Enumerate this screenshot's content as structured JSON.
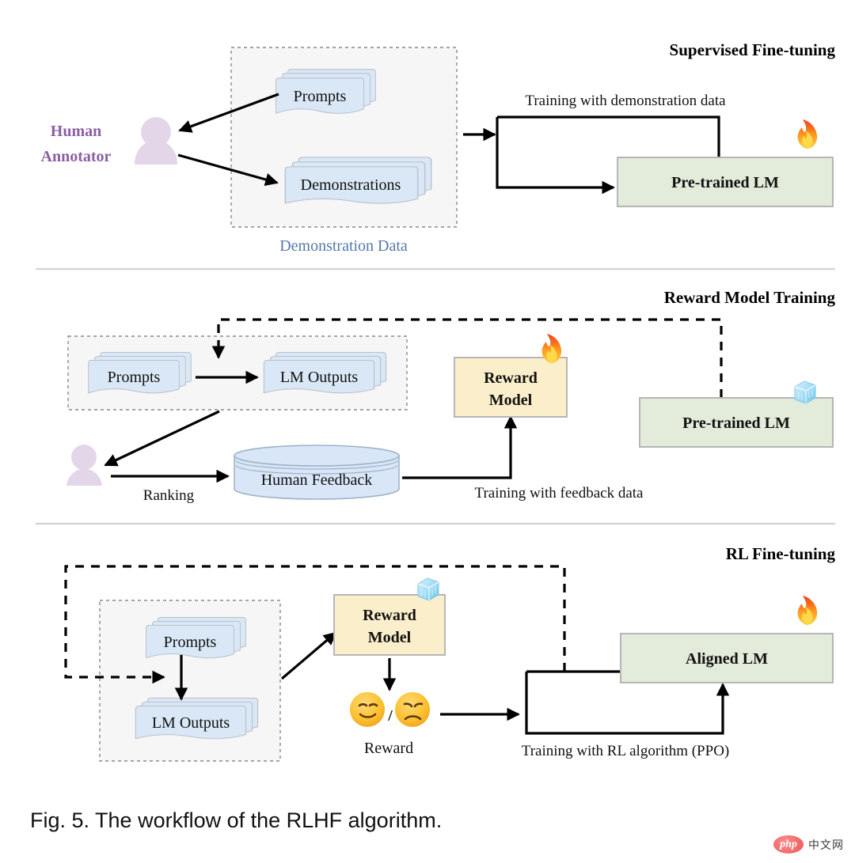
{
  "figure": {
    "caption": "Fig. 5. The workflow of the RLHF algorithm.",
    "watermark": {
      "brand": "php",
      "suffix": "中文网"
    },
    "colors": {
      "doc_fill": "#dae7f6",
      "green_box_fill": "#e3ebda",
      "cream_box_fill": "#fbeecb",
      "cylinder_fill": "#d8e6f7",
      "actor_fill": "#e4d6e9",
      "actor_label": "#8a5fa3",
      "group_label": "#5577aa",
      "dashed_group_fill": "#f6f6f6",
      "arrow": "#000000",
      "divider": "#d2d2d2"
    }
  },
  "panels": [
    {
      "id": "supervised-fine-tuning",
      "title": "Supervised Fine-tuning",
      "actor": {
        "line1": "Human",
        "line2": "Annotator",
        "icon": "person-icon"
      },
      "group": {
        "label": "Demonstration Data"
      },
      "docs": [
        {
          "id": "prompts",
          "label": "Prompts"
        },
        {
          "id": "demonstrations",
          "label": "Demonstrations"
        }
      ],
      "model": {
        "label": "Pre-trained LM",
        "state_icon": "fire-icon",
        "state": "trainable"
      },
      "edges": [
        {
          "id": "training-with-demonstration-data",
          "label": "Training with demonstration data"
        }
      ]
    },
    {
      "id": "reward-model-training",
      "title": "Reward Model Training",
      "actor": {
        "line1": "",
        "line2": "",
        "icon": "person-icon"
      },
      "docs": [
        {
          "id": "prompts",
          "label": "Prompts"
        },
        {
          "id": "lm-outputs",
          "label": "LM Outputs"
        }
      ],
      "store": {
        "label": "Human Feedback",
        "icon": "database-icon"
      },
      "reward_model": {
        "line1": "Reward",
        "line2": "Model",
        "state_icon": "fire-icon",
        "state": "trainable"
      },
      "model": {
        "label": "Pre-trained LM",
        "state_icon": "ice-icon",
        "state": "frozen"
      },
      "edges": [
        {
          "id": "ranking",
          "label": "Ranking"
        },
        {
          "id": "training-with-feedback-data",
          "label": "Training with feedback data"
        }
      ]
    },
    {
      "id": "rl-fine-tuning",
      "title": "RL Fine-tuning",
      "docs": [
        {
          "id": "prompts",
          "label": "Prompts"
        },
        {
          "id": "lm-outputs",
          "label": "LM Outputs"
        }
      ],
      "reward_model": {
        "line1": "Reward",
        "line2": "Model",
        "state_icon": "ice-icon",
        "state": "frozen"
      },
      "reward_signal": {
        "label": "Reward",
        "positive_icon": "smiling-face-icon",
        "separator": "/",
        "negative_icon": "disappointed-face-icon"
      },
      "model": {
        "label": "Aligned LM",
        "state_icon": "fire-icon",
        "state": "trainable"
      },
      "edges": [
        {
          "id": "training-with-rl-algorithm",
          "label": "Training with RL algorithm (PPO)"
        }
      ]
    }
  ]
}
